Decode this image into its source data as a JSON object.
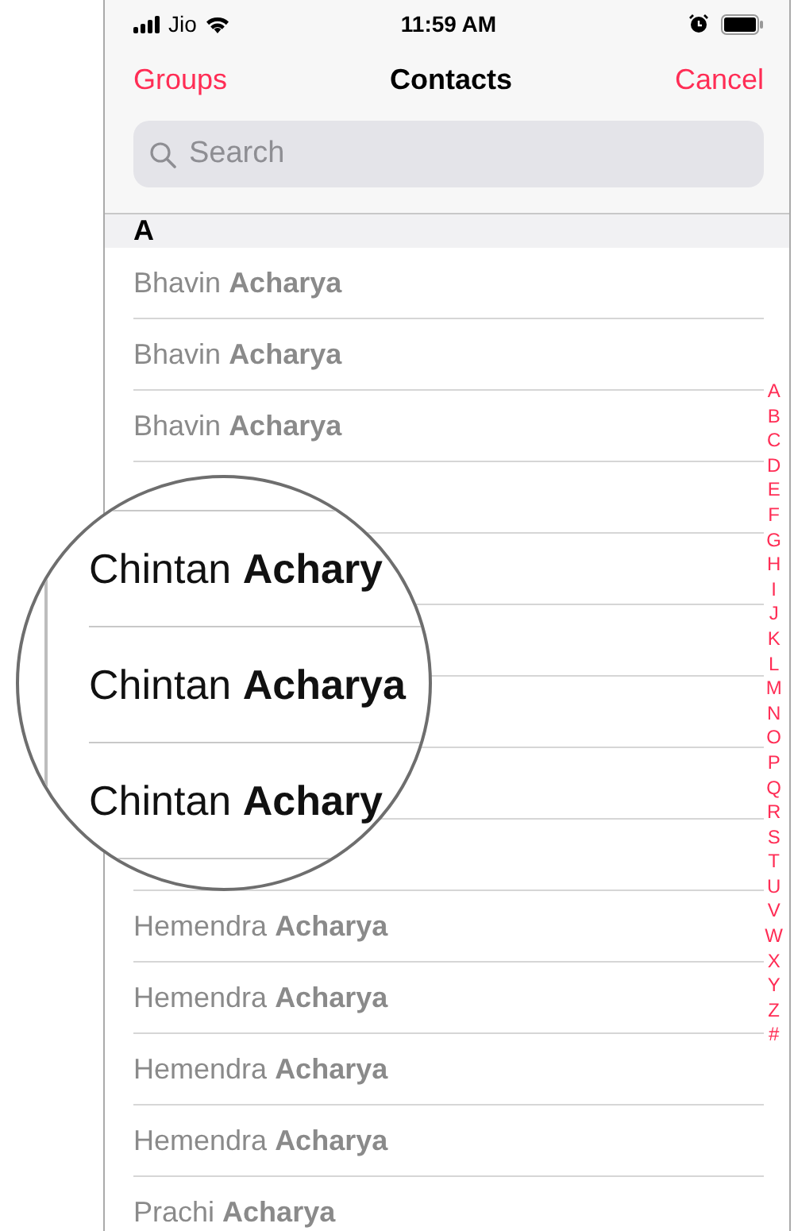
{
  "status_bar": {
    "carrier": "Jio",
    "time": "11:59 AM"
  },
  "nav": {
    "left": "Groups",
    "title": "Contacts",
    "right": "Cancel"
  },
  "search": {
    "placeholder": "Search"
  },
  "section": {
    "letter": "A"
  },
  "rows_before": [
    {
      "first": "Bhavin",
      "last": "Acharya"
    },
    {
      "first": "Bhavin",
      "last": "Acharya"
    },
    {
      "first": "Bhavin",
      "last": "Acharya"
    }
  ],
  "rows_after": [
    {
      "first": "Hemendra",
      "last": "Acharya"
    },
    {
      "first": "Hemendra",
      "last": "Acharya"
    },
    {
      "first": "Hemendra",
      "last": "Acharya"
    },
    {
      "first": "Hemendra",
      "last": "Acharya"
    },
    {
      "first": "Prachi",
      "last": "Acharya"
    }
  ],
  "magnifier": {
    "rows": [
      {
        "first": "Chintan",
        "last": "Achary"
      },
      {
        "first": "Chintan",
        "last": "Acharya"
      },
      {
        "first": "Chintan",
        "last": "Achary"
      }
    ]
  },
  "index": [
    "A",
    "B",
    "C",
    "D",
    "E",
    "F",
    "G",
    "H",
    "I",
    "J",
    "K",
    "L",
    "M",
    "N",
    "O",
    "P",
    "Q",
    "R",
    "S",
    "T",
    "U",
    "V",
    "W",
    "X",
    "Y",
    "Z",
    "#"
  ]
}
